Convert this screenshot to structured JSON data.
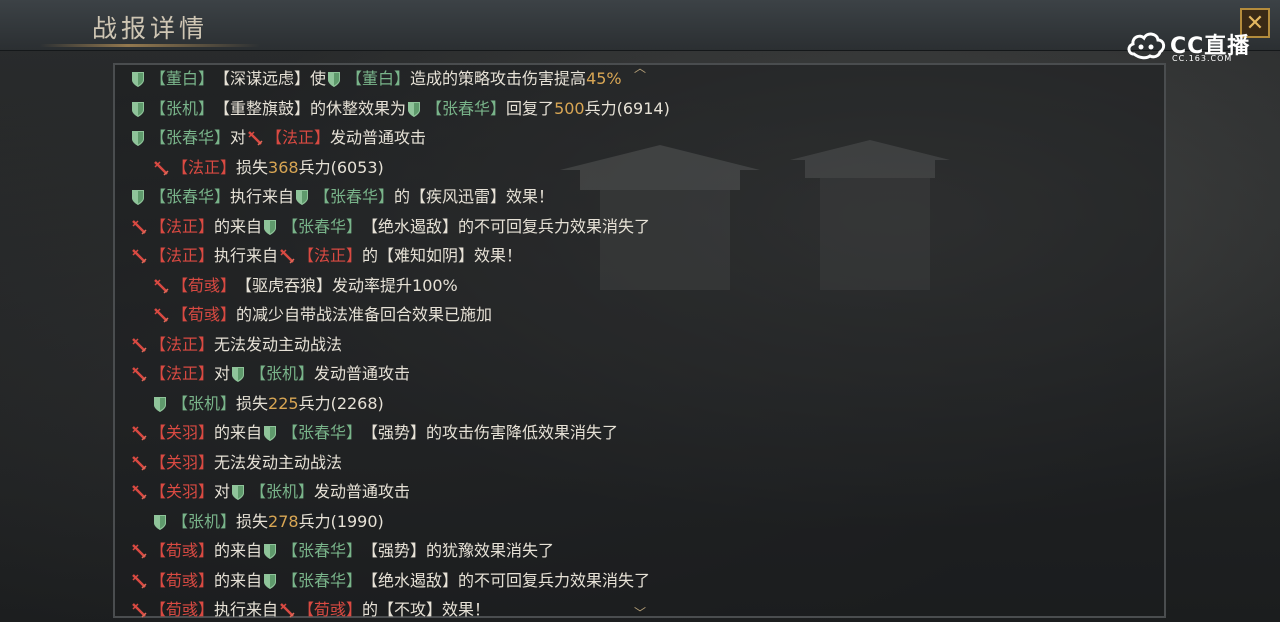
{
  "header": {
    "title": "战报详情",
    "close_label": "✕"
  },
  "logo": {
    "brand": "CC直播",
    "url": "CC.163.COM"
  },
  "colors": {
    "ally": "#79b48a",
    "enemy": "#d94a42",
    "highlight": "#d8a654"
  },
  "log": [
    {
      "segs": [
        {
          "i": "shield"
        },
        {
          "t": "【董白】",
          "c": "g"
        },
        {
          "t": "【深谋远虑】使"
        },
        {
          "i": "shield"
        },
        {
          "t": "【董白】",
          "c": "g"
        },
        {
          "t": "造成的策略攻击伤害提高"
        },
        {
          "t": "45%",
          "c": "h"
        }
      ]
    },
    {
      "segs": [
        {
          "i": "shield"
        },
        {
          "t": "【张机】",
          "c": "g"
        },
        {
          "t": "【重整旗鼓】的休整效果为"
        },
        {
          "i": "shield"
        },
        {
          "t": "【张春华】",
          "c": "g"
        },
        {
          "t": "回复了"
        },
        {
          "t": "500",
          "c": "h"
        },
        {
          "t": "兵力(6914)"
        }
      ]
    },
    {
      "segs": [
        {
          "i": "shield"
        },
        {
          "t": "【张春华】",
          "c": "g"
        },
        {
          "t": "对"
        },
        {
          "i": "sword"
        },
        {
          "t": "【法正】",
          "c": "r"
        },
        {
          "t": "发动普通攻击"
        }
      ]
    },
    {
      "segs": [
        {
          "i": "sword"
        },
        {
          "t": "【法正】",
          "c": "r"
        },
        {
          "t": "损失"
        },
        {
          "t": "368",
          "c": "h"
        },
        {
          "t": "兵力(6053)"
        }
      ]
    },
    {
      "segs": [
        {
          "i": "shield"
        },
        {
          "t": "【张春华】",
          "c": "g"
        },
        {
          "t": "执行来自"
        },
        {
          "i": "shield"
        },
        {
          "t": "【张春华】",
          "c": "g"
        },
        {
          "t": "的【疾风迅雷】效果！"
        }
      ]
    },
    {
      "segs": [
        {
          "i": "sword"
        },
        {
          "t": "【法正】",
          "c": "r"
        },
        {
          "t": "的来自"
        },
        {
          "i": "shield"
        },
        {
          "t": "【张春华】",
          "c": "g"
        },
        {
          "t": "【绝水遏敌】的不可回复兵力效果消失了"
        }
      ]
    },
    {
      "segs": [
        {
          "i": "sword"
        },
        {
          "t": "【法正】",
          "c": "r"
        },
        {
          "t": "执行来自"
        },
        {
          "i": "sword"
        },
        {
          "t": "【法正】",
          "c": "r"
        },
        {
          "t": "的【难知如阴】效果！"
        }
      ]
    },
    {
      "segs": [
        {
          "i": "sword"
        },
        {
          "t": "【荀彧】",
          "c": "r"
        },
        {
          "t": "【驱虎吞狼】发动率提升100%"
        }
      ]
    },
    {
      "segs": [
        {
          "i": "sword"
        },
        {
          "t": "【荀彧】",
          "c": "r"
        },
        {
          "t": "的减少自带战法准备回合效果已施加"
        }
      ]
    },
    {
      "segs": [
        {
          "i": "sword"
        },
        {
          "t": "【法正】",
          "c": "r"
        },
        {
          "t": "无法发动主动战法"
        }
      ]
    },
    {
      "segs": [
        {
          "i": "sword"
        },
        {
          "t": "【法正】",
          "c": "r"
        },
        {
          "t": "对"
        },
        {
          "i": "shield"
        },
        {
          "t": "【张机】",
          "c": "g"
        },
        {
          "t": "发动普通攻击"
        }
      ]
    },
    {
      "segs": [
        {
          "i": "shield"
        },
        {
          "t": "【张机】",
          "c": "g"
        },
        {
          "t": "损失"
        },
        {
          "t": "225",
          "c": "h"
        },
        {
          "t": "兵力(2268)"
        }
      ]
    },
    {
      "segs": [
        {
          "i": "sword"
        },
        {
          "t": "【关羽】",
          "c": "r"
        },
        {
          "t": "的来自"
        },
        {
          "i": "shield"
        },
        {
          "t": "【张春华】",
          "c": "g"
        },
        {
          "t": "【强势】的攻击伤害降低效果消失了"
        }
      ]
    },
    {
      "segs": [
        {
          "i": "sword"
        },
        {
          "t": "【关羽】",
          "c": "r"
        },
        {
          "t": "无法发动主动战法"
        }
      ]
    },
    {
      "segs": [
        {
          "i": "sword"
        },
        {
          "t": "【关羽】",
          "c": "r"
        },
        {
          "t": "对"
        },
        {
          "i": "shield"
        },
        {
          "t": "【张机】",
          "c": "g"
        },
        {
          "t": "发动普通攻击"
        }
      ]
    },
    {
      "segs": [
        {
          "i": "shield"
        },
        {
          "t": "【张机】",
          "c": "g"
        },
        {
          "t": "损失"
        },
        {
          "t": "278",
          "c": "h"
        },
        {
          "t": "兵力(1990)"
        }
      ]
    },
    {
      "segs": [
        {
          "i": "sword"
        },
        {
          "t": "【荀彧】",
          "c": "r"
        },
        {
          "t": "的来自"
        },
        {
          "i": "shield"
        },
        {
          "t": "【张春华】",
          "c": "g"
        },
        {
          "t": "【强势】的犹豫效果消失了"
        }
      ]
    },
    {
      "segs": [
        {
          "i": "sword"
        },
        {
          "t": "【荀彧】",
          "c": "r"
        },
        {
          "t": "的来自"
        },
        {
          "i": "shield"
        },
        {
          "t": "【张春华】",
          "c": "g"
        },
        {
          "t": "【绝水遏敌】的不可回复兵力效果消失了"
        }
      ]
    },
    {
      "segs": [
        {
          "i": "sword"
        },
        {
          "t": "【荀彧】",
          "c": "r"
        },
        {
          "t": "执行来自"
        },
        {
          "i": "sword"
        },
        {
          "t": "【荀彧】",
          "c": "r"
        },
        {
          "t": "的【不攻】效果！"
        }
      ]
    }
  ]
}
